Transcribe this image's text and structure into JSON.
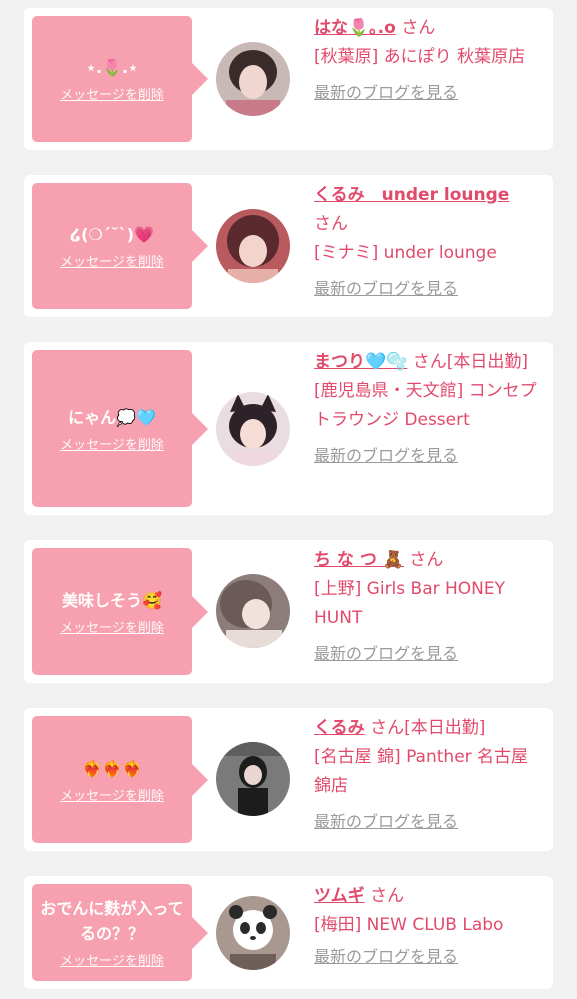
{
  "cards": [
    {
      "message": "⋆.🌷.⋆",
      "delete_label": "メッセージを削除",
      "name": "はな🌷｡.o",
      "san": "さん",
      "shop": "[秋葉原] あにぽり 秋葉原店",
      "blog_label": "最新のブログを見る",
      "avatar_colors": [
        "#3a2a2a",
        "#c97a8a"
      ]
    },
    {
      "message": "໒(❍ˊ˘ˋ)💗",
      "delete_label": "メッセージを削除",
      "name": "くるみ　under lounge",
      "san": "さん",
      "shop": "[ミナミ] under lounge",
      "blog_label": "最新のブログを見る",
      "avatar_colors": [
        "#5a2a2e",
        "#e6b0a8"
      ]
    },
    {
      "message": "にゃん💭🩵",
      "delete_label": "メッセージを削除",
      "name": "まつり🩵🫧",
      "san": "さん[本日出勤]",
      "shop": "[鹿児島県・天文館] コンセプトラウンジ Dessert",
      "blog_label": "最新のブログを見る",
      "avatar_colors": [
        "#2c2228",
        "#f0d8e0"
      ]
    },
    {
      "message": "美味しそう🥰",
      "delete_label": "メッセージを削除",
      "name": "ち な つ 🧸",
      "san": "さん",
      "shop": "[上野] Girls Bar HONEY HUNT",
      "blog_label": "最新のブログを見る",
      "avatar_colors": [
        "#6b5a58",
        "#e8dcd8"
      ]
    },
    {
      "message": "❤️‍🔥❤️‍🔥❤️‍🔥",
      "delete_label": "メッセージを削除",
      "name": "くるみ",
      "san": "さん[本日出勤]",
      "shop": "[名古屋 錦] Panther 名古屋錦店",
      "blog_label": "最新のブログを見る",
      "avatar_colors": [
        "#7a7a7a",
        "#1c1c1c"
      ]
    },
    {
      "message": "おでんに麩が入ってるの？？",
      "delete_label": "メッセージを削除",
      "name": "ツムギ",
      "san": "さん",
      "shop": "[梅田] NEW CLUB Labo",
      "blog_label": "最新のブログを見る",
      "avatar_colors": [
        "#a89890",
        "#2a2a2a"
      ]
    }
  ]
}
